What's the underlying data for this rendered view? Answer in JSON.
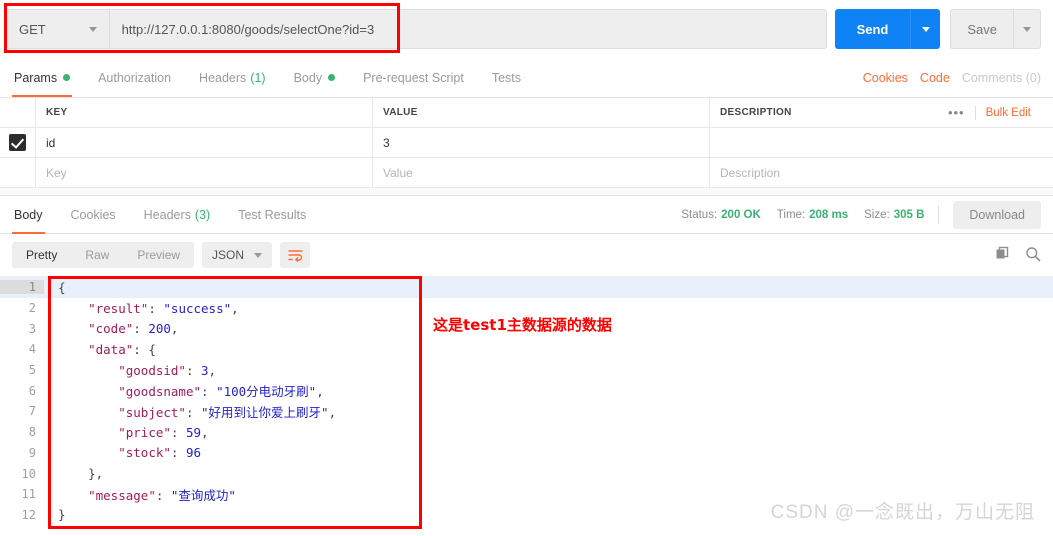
{
  "request": {
    "method": "GET",
    "url": "http://127.0.0.1:8080/goods/selectOne?id=3",
    "send_label": "Send",
    "save_label": "Save",
    "tabs": [
      {
        "label": "Params",
        "dot": true,
        "count": "",
        "active": true
      },
      {
        "label": "Authorization",
        "dot": false,
        "count": "",
        "active": false
      },
      {
        "label": "Headers",
        "dot": false,
        "count": "(1)",
        "active": false
      },
      {
        "label": "Body",
        "dot": true,
        "count": "",
        "active": false
      },
      {
        "label": "Pre-request Script",
        "dot": false,
        "count": "",
        "active": false
      },
      {
        "label": "Tests",
        "dot": false,
        "count": "",
        "active": false
      }
    ],
    "links": {
      "cookies": "Cookies",
      "code": "Code",
      "comments": "Comments (0)"
    }
  },
  "params_table": {
    "headers": {
      "key": "KEY",
      "value": "VALUE",
      "description": "DESCRIPTION"
    },
    "bulk_edit": "Bulk Edit",
    "more_dots": "•••",
    "rows": [
      {
        "checked": true,
        "key": "id",
        "value": "3",
        "description": ""
      }
    ],
    "placeholders": {
      "key": "Key",
      "value": "Value",
      "description": "Description"
    }
  },
  "response": {
    "tabs": [
      {
        "label": "Body",
        "count": "",
        "active": true
      },
      {
        "label": "Cookies",
        "count": "",
        "active": false
      },
      {
        "label": "Headers",
        "count": "(3)",
        "active": false
      },
      {
        "label": "Test Results",
        "count": "",
        "active": false
      }
    ],
    "status_label": "Status:",
    "status_value": "200 OK",
    "time_label": "Time:",
    "time_value": "208 ms",
    "size_label": "Size:",
    "size_value": "305 B",
    "download_label": "Download",
    "format_tabs": [
      {
        "label": "Pretty",
        "active": true
      },
      {
        "label": "Raw",
        "active": false
      },
      {
        "label": "Preview",
        "active": false
      }
    ],
    "language": "JSON",
    "body_lines": [
      {
        "n": "1",
        "segs": [
          {
            "t": "p",
            "v": "{"
          }
        ]
      },
      {
        "n": "2",
        "segs": [
          {
            "t": "p",
            "v": "    "
          },
          {
            "t": "k",
            "v": "\"result\""
          },
          {
            "t": "p",
            "v": ": "
          },
          {
            "t": "s",
            "v": "\"success\""
          },
          {
            "t": "p",
            "v": ","
          }
        ]
      },
      {
        "n": "3",
        "segs": [
          {
            "t": "p",
            "v": "    "
          },
          {
            "t": "k",
            "v": "\"code\""
          },
          {
            "t": "p",
            "v": ": "
          },
          {
            "t": "n",
            "v": "200"
          },
          {
            "t": "p",
            "v": ","
          }
        ]
      },
      {
        "n": "4",
        "segs": [
          {
            "t": "p",
            "v": "    "
          },
          {
            "t": "k",
            "v": "\"data\""
          },
          {
            "t": "p",
            "v": ": {"
          }
        ]
      },
      {
        "n": "5",
        "segs": [
          {
            "t": "p",
            "v": "        "
          },
          {
            "t": "k",
            "v": "\"goodsid\""
          },
          {
            "t": "p",
            "v": ": "
          },
          {
            "t": "n",
            "v": "3"
          },
          {
            "t": "p",
            "v": ","
          }
        ]
      },
      {
        "n": "6",
        "segs": [
          {
            "t": "p",
            "v": "        "
          },
          {
            "t": "k",
            "v": "\"goodsname\""
          },
          {
            "t": "p",
            "v": ": "
          },
          {
            "t": "s",
            "v": "\"100分电动牙刷\""
          },
          {
            "t": "p",
            "v": ","
          }
        ]
      },
      {
        "n": "7",
        "segs": [
          {
            "t": "p",
            "v": "        "
          },
          {
            "t": "k",
            "v": "\"subject\""
          },
          {
            "t": "p",
            "v": ": "
          },
          {
            "t": "s",
            "v": "\"好用到让你爱上刷牙\""
          },
          {
            "t": "p",
            "v": ","
          }
        ]
      },
      {
        "n": "8",
        "segs": [
          {
            "t": "p",
            "v": "        "
          },
          {
            "t": "k",
            "v": "\"price\""
          },
          {
            "t": "p",
            "v": ": "
          },
          {
            "t": "n",
            "v": "59"
          },
          {
            "t": "p",
            "v": ","
          }
        ]
      },
      {
        "n": "9",
        "segs": [
          {
            "t": "p",
            "v": "        "
          },
          {
            "t": "k",
            "v": "\"stock\""
          },
          {
            "t": "p",
            "v": ": "
          },
          {
            "t": "n",
            "v": "96"
          }
        ]
      },
      {
        "n": "10",
        "segs": [
          {
            "t": "p",
            "v": "    },"
          }
        ]
      },
      {
        "n": "11",
        "segs": [
          {
            "t": "p",
            "v": "    "
          },
          {
            "t": "k",
            "v": "\"message\""
          },
          {
            "t": "p",
            "v": ": "
          },
          {
            "t": "s",
            "v": "\"查询成功\""
          }
        ]
      },
      {
        "n": "12",
        "segs": [
          {
            "t": "p",
            "v": "}"
          }
        ]
      }
    ]
  },
  "annotation": {
    "text": "这是test1主数据源的数据",
    "color": "#ff0000"
  },
  "watermark": {
    "text": "CSDN @一念既出，万山无阻"
  },
  "colors": {
    "accent": "#ff6c37",
    "send": "#0f83f5",
    "success": "#3bb273",
    "annotation": "#ff0000"
  }
}
